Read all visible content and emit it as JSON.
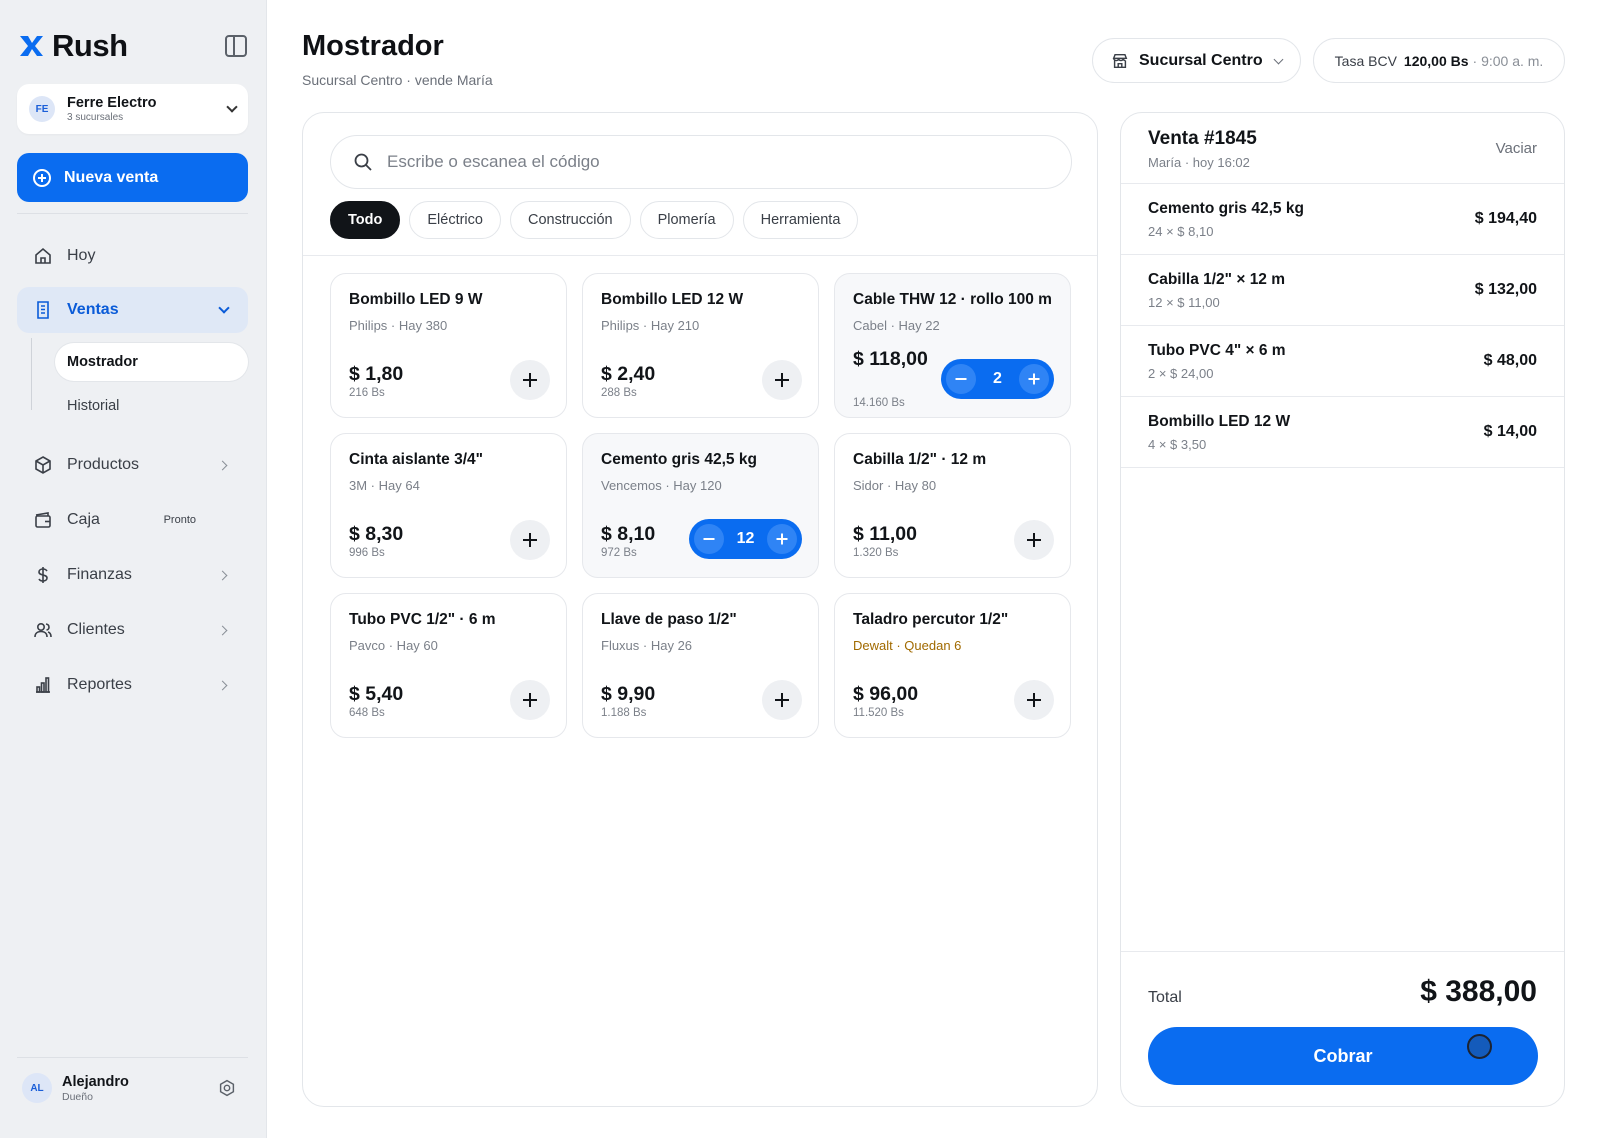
{
  "brand": {
    "name": "Rush",
    "accent": "#0a6cf0"
  },
  "org": {
    "initials": "FE",
    "name": "Ferre Electro",
    "sub": "3 sucursales"
  },
  "sidebar": {
    "new_sale_label": "Nueva venta",
    "items": [
      {
        "label": "Hoy",
        "icon": "home-icon"
      },
      {
        "label": "Ventas",
        "icon": "receipt-icon"
      },
      {
        "label": "Productos",
        "icon": "box-icon"
      },
      {
        "label": "Caja",
        "icon": "wallet-icon",
        "badge": "Pronto"
      },
      {
        "label": "Finanzas",
        "icon": "dollar-icon"
      },
      {
        "label": "Clientes",
        "icon": "users-icon"
      },
      {
        "label": "Reportes",
        "icon": "bar-chart-icon"
      }
    ],
    "sub_items": [
      {
        "label": "Mostrador"
      },
      {
        "label": "Historial"
      }
    ]
  },
  "user": {
    "initials": "AL",
    "name": "Alejandro",
    "role": "Dueño"
  },
  "header": {
    "title": "Mostrador",
    "subtitle": "Sucursal Centro · vende María",
    "branch": "Sucursal Centro",
    "rate_label": "Tasa BCV",
    "rate_value": "120,00 Bs",
    "rate_time": "· 9:00 a. m."
  },
  "search": {
    "placeholder": "Escribe o escanea el código"
  },
  "filters": [
    "Todo",
    "Eléctrico",
    "Construcción",
    "Plomería",
    "Herramienta"
  ],
  "products": [
    {
      "name": "Bombillo LED 9 W",
      "meta": "Philips · Hay 380",
      "price": "$ 1,80",
      "bs": "216 Bs"
    },
    {
      "name": "Bombillo LED 12 W",
      "meta": "Philips · Hay 210",
      "price": "$ 2,40",
      "bs": "288 Bs"
    },
    {
      "name": "Cable THW 12 · rollo 100 m",
      "meta": "Cabel · Hay 22",
      "price": "$ 118,00",
      "bs": "14.160 Bs",
      "qty": "2"
    },
    {
      "name": "Cinta aislante 3/4\"",
      "meta": "3M · Hay 64",
      "price": "$ 8,30",
      "bs": "996 Bs"
    },
    {
      "name": "Cemento gris 42,5 kg",
      "meta": "Vencemos · Hay 120",
      "price": "$ 8,10",
      "bs": "972 Bs",
      "qty": "12"
    },
    {
      "name": "Cabilla 1/2\" · 12 m",
      "meta": "Sidor · Hay 80",
      "price": "$ 11,00",
      "bs": "1.320 Bs"
    },
    {
      "name": "Tubo PVC 1/2\" · 6 m",
      "meta": "Pavco · Hay 60",
      "price": "$ 5,40",
      "bs": "648 Bs"
    },
    {
      "name": "Llave de paso 1/2\"",
      "meta": "Fluxus · Hay 26",
      "price": "$ 9,90",
      "bs": "1.188 Bs"
    },
    {
      "name": "Taladro percutor 1/2\"",
      "meta": "Dewalt · Quedan 6",
      "price": "$ 96,00",
      "bs": "11.520 Bs"
    }
  ],
  "order": {
    "title": "Venta #1845",
    "subtitle": "María · hoy 16:02",
    "clear_label": "Vaciar",
    "lines": [
      {
        "name": "Cemento gris 42,5 kg",
        "qty": "24 × $ 8,10",
        "total": "$ 194,40"
      },
      {
        "name": "Cabilla 1/2\" × 12 m",
        "qty": "12 × $ 11,00",
        "total": "$ 132,00"
      },
      {
        "name": "Tubo PVC 4\" × 6 m",
        "qty": "2 × $ 24,00",
        "total": "$ 48,00"
      },
      {
        "name": "Bombillo LED 12 W",
        "qty": "4 × $ 3,50",
        "total": "$ 14,00"
      }
    ],
    "total_label": "Total",
    "total_value": "$ 388,00",
    "pay_label": "Cobrar"
  }
}
